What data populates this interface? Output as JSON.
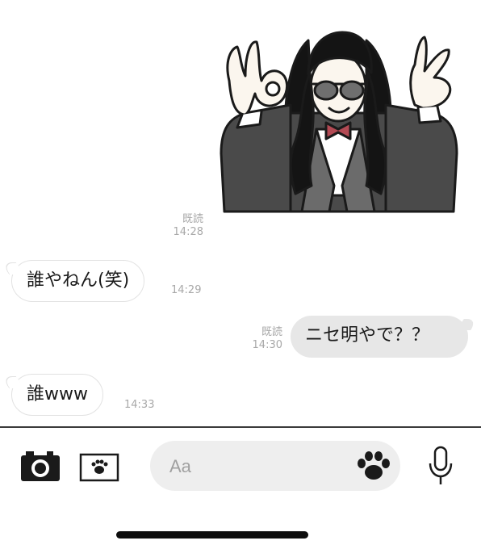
{
  "messages": [
    {
      "type": "sticker",
      "direction": "outgoing",
      "sticker_icon": "ok-hands-man-sticker",
      "status": "既読",
      "time": "14:28"
    },
    {
      "type": "text",
      "direction": "incoming",
      "text": "誰やねん(笑)",
      "time": "14:29"
    },
    {
      "type": "text",
      "direction": "outgoing",
      "text": "ニセ明やで？？",
      "status": "既読",
      "time": "14:30"
    },
    {
      "type": "text",
      "direction": "incoming",
      "text": "誰www",
      "time": "14:33"
    }
  ],
  "composer": {
    "placeholder": "Aa",
    "icons": [
      "camera-icon",
      "image-icon",
      "paw-sticker-icon",
      "microphone-icon"
    ]
  },
  "colors": {
    "outgoing_bubble": "#e7e7e7",
    "incoming_bubble": "#ffffff",
    "meta_text": "#a8a8a8",
    "input_bg": "#eeeeee"
  }
}
